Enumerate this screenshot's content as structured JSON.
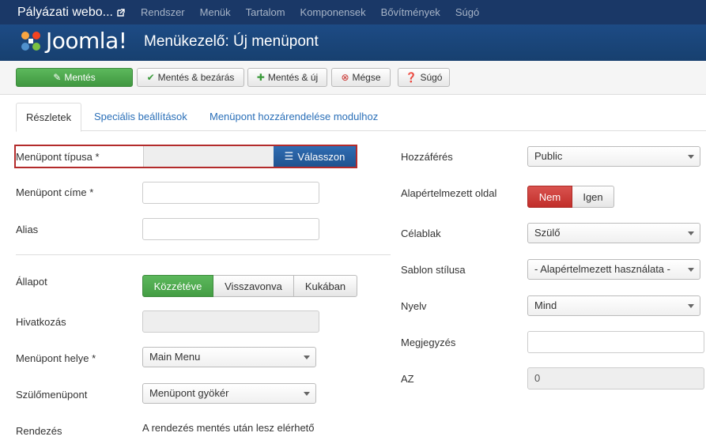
{
  "topnav": {
    "site_name": "Pályázati webo...",
    "menu": [
      "Rendszer",
      "Menük",
      "Tartalom",
      "Komponensek",
      "Bővítmények",
      "Súgó"
    ]
  },
  "header": {
    "logo_text": "Joomla!",
    "title": "Menükezelő: Új menüpont"
  },
  "toolbar": {
    "save": "Mentés",
    "save_close": "Mentés & bezárás",
    "save_new": "Mentés & új",
    "cancel": "Mégse",
    "help": "Súgó"
  },
  "tabs": [
    "Részletek",
    "Speciális beállítások",
    "Menüpont hozzárendelése modulhoz"
  ],
  "left": {
    "type_label": "Menüpont típusa *",
    "choose_button": "Válasszon",
    "title_label": "Menüpont címe *",
    "title_value": "",
    "alias_label": "Alias",
    "alias_value": "",
    "status_label": "Állapot",
    "status_options": [
      "Közzétéve",
      "Visszavonva",
      "Kukában"
    ],
    "link_label": "Hivatkozás",
    "menu_label": "Menüpont helye *",
    "menu_value": "Main Menu",
    "parent_label": "Szülőmenüpont",
    "parent_value": "Menüpont gyökér",
    "ordering_label": "Rendezés",
    "ordering_text": "A rendezés mentés után lesz elérhető"
  },
  "right": {
    "access_label": "Hozzáférés",
    "access_value": "Public",
    "home_label": "Alapértelmezett oldal",
    "home_options": [
      "Nem",
      "Igen"
    ],
    "target_label": "Célablak",
    "target_value": "Szülő",
    "template_label": "Sablon stílusa",
    "template_value": "- Alapértelmezett használata -",
    "language_label": "Nyelv",
    "language_value": "Mind",
    "note_label": "Megjegyzés",
    "note_value": "",
    "id_label": "AZ",
    "id_value": "0"
  },
  "colors": {
    "topnav": "#1a3867",
    "header": "#1d4b85",
    "save_green": "#5cb85c",
    "choose_blue": "#2f6db3",
    "highlight_red": "#b32b2b",
    "no_red": "#d9534f",
    "link_blue": "#2a6fb8"
  }
}
